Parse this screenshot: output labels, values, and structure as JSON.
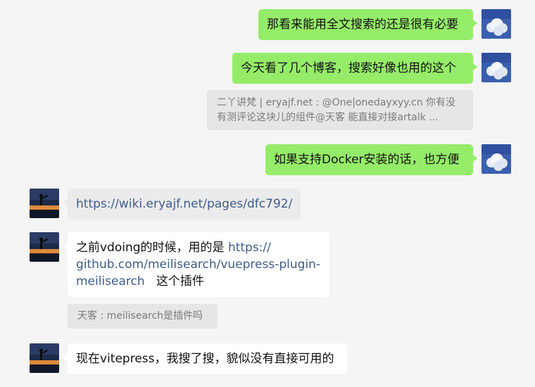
{
  "messages": [
    {
      "id": "m1",
      "side": "me",
      "text": "那看来能用全文搜索的还是很有必要"
    },
    {
      "id": "m2",
      "side": "me",
      "text": "今天看了几个博客，搜索好像也用的这个"
    },
    {
      "id": "q1",
      "side": "quote",
      "line1": "二丫讲梵 | eryajf.net : @One|onedayxyy.cn 你有没",
      "line2": "有测评论这块儿的组件@天客  能直接对接artalk ..."
    },
    {
      "id": "m3",
      "side": "me",
      "text": "如果支持Docker安装的话，也方便"
    },
    {
      "id": "m4",
      "side": "other",
      "link": "https://wiki.eryajf.net/pages/dfc792/"
    },
    {
      "id": "m5",
      "side": "other",
      "prefix": "之前vdoing的时候，用的是 ",
      "link1": "https://",
      "link2": "github.com/meilisearch/vuepress-plugin-",
      "link3": "meilisearch",
      "suffix": "这个插件"
    },
    {
      "id": "q2",
      "side": "quote",
      "text": "天客 : meilisearch是插件吗"
    },
    {
      "id": "m6",
      "side": "other",
      "text": "现在vitepress，我搜了搜，貌似没有直接可用的"
    }
  ],
  "colors": {
    "me_bubble": "#95ec69",
    "other_bubble": "#ffffff",
    "link": "#3e5c8a",
    "background": "#f5f5f5"
  },
  "icons": {
    "self_avatar": "sky-clouds-avatar",
    "peer_avatar": "sunset-silhouette-avatar"
  }
}
